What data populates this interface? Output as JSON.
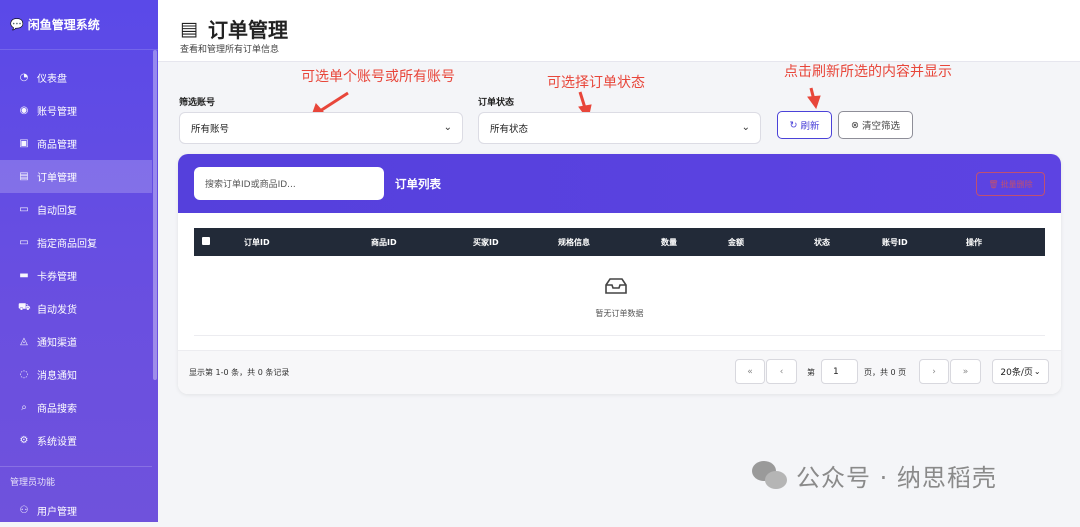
{
  "app": {
    "title": "闲鱼管理系统"
  },
  "sidebar": {
    "items": [
      {
        "label": "仪表盘",
        "icon": "dashboard-icon",
        "glyph": "◔"
      },
      {
        "label": "账号管理",
        "icon": "user-circle-icon",
        "glyph": "◉"
      },
      {
        "label": "商品管理",
        "icon": "box-icon",
        "glyph": "▣"
      },
      {
        "label": "订单管理",
        "icon": "order-list-icon",
        "glyph": "▤"
      },
      {
        "label": "自动回复",
        "icon": "chat-icon",
        "glyph": "▭"
      },
      {
        "label": "指定商品回复",
        "icon": "chat-square-icon",
        "glyph": "▭"
      },
      {
        "label": "卡券管理",
        "icon": "card-icon",
        "glyph": "▬"
      },
      {
        "label": "自动发货",
        "icon": "truck-icon",
        "glyph": "⛟"
      },
      {
        "label": "通知渠道",
        "icon": "bell-icon",
        "glyph": "◬"
      },
      {
        "label": "消息通知",
        "icon": "message-dots-icon",
        "glyph": "◌"
      },
      {
        "label": "商品搜索",
        "icon": "search-icon",
        "glyph": "⌕"
      },
      {
        "label": "系统设置",
        "icon": "gear-icon",
        "glyph": "⚙"
      }
    ],
    "active_index": 3,
    "admin_section": "管理员功能",
    "admin_items": [
      {
        "label": "用户管理",
        "icon": "users-icon",
        "glyph": "⚇"
      }
    ]
  },
  "header": {
    "title": "订单管理",
    "subtitle": "查看和管理所有订单信息"
  },
  "annotations": {
    "account": "可选单个账号或所有账号",
    "status": "可选择订单状态",
    "refresh": "点击刷新所选的内容并显示"
  },
  "filters": {
    "account_label": "筛选账号",
    "account_value": "所有账号",
    "status_label": "订单状态",
    "status_value": "所有状态",
    "refresh_label": "刷新",
    "clear_label": "清空筛选"
  },
  "table": {
    "search_placeholder": "搜索订单ID或商品ID...",
    "title": "订单列表",
    "bulk_delete": "批量删除",
    "columns": [
      "订单ID",
      "商品ID",
      "买家ID",
      "规格信息",
      "数量",
      "金额",
      "状态",
      "账号ID",
      "操作"
    ],
    "empty_text": "暂无订单数据"
  },
  "pagination": {
    "info": "显示第 1-0 条，共 0 条记录",
    "page_prefix": "第",
    "page_value": "1",
    "page_suffix": "页，共 0 页",
    "page_size": "20条/页"
  },
  "watermark": "公众号 · 纳思稻壳",
  "colors": {
    "sidebar": "#5a49e8",
    "accent": "#4b42d8",
    "annotation": "#e8463a",
    "table_header": "#222a38"
  }
}
